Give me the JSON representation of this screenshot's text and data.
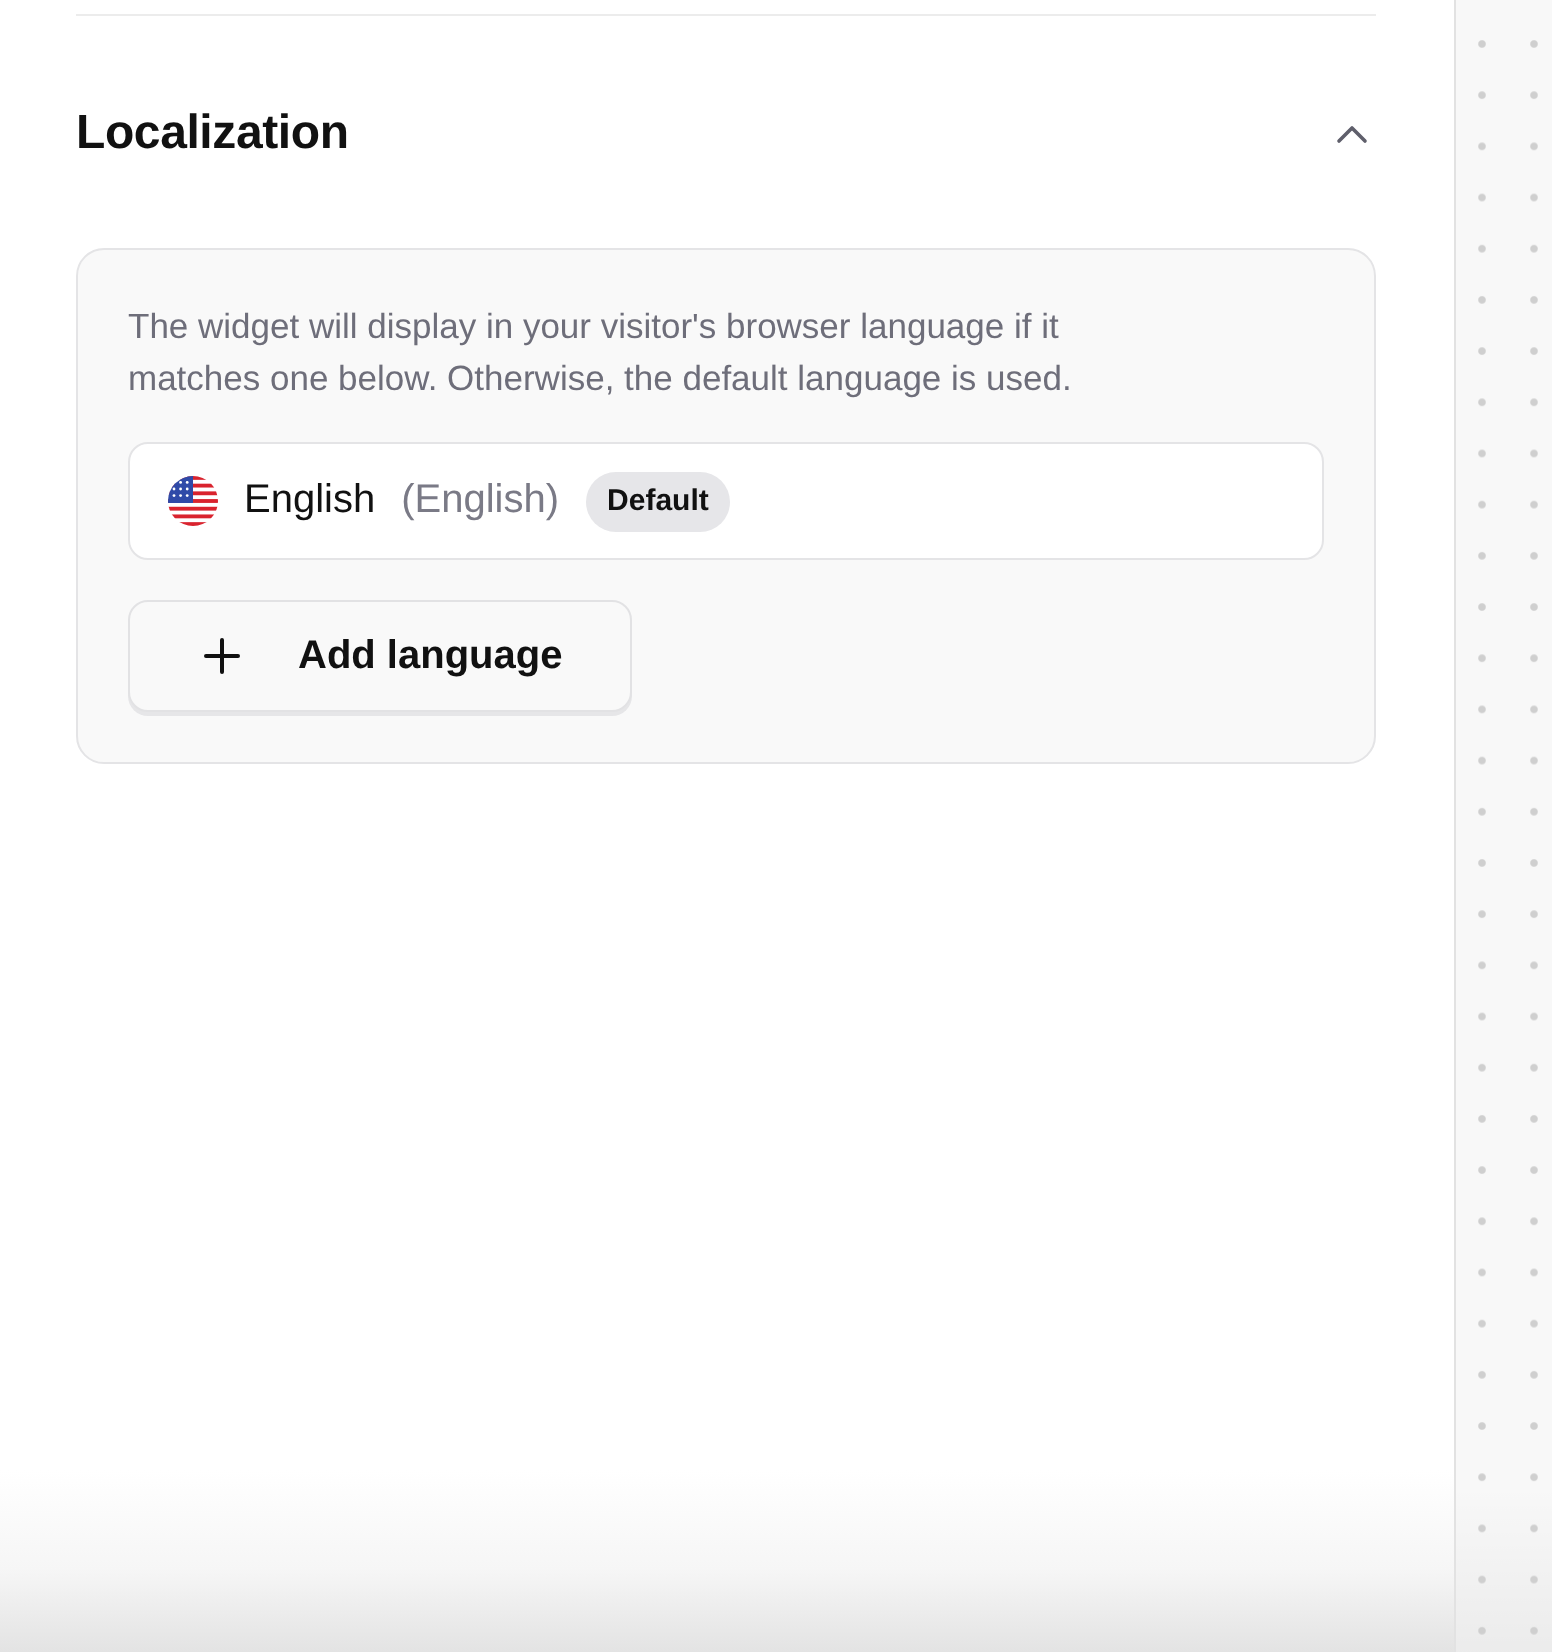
{
  "section": {
    "title": "Localization",
    "expanded": true
  },
  "description": "The widget will display in your visitor's browser language if it matches one below. Otherwise, the default language is used.",
  "languages": [
    {
      "name": "English",
      "native_name": "(English)",
      "badge": "Default"
    }
  ],
  "add_button": {
    "label": "Add language"
  }
}
